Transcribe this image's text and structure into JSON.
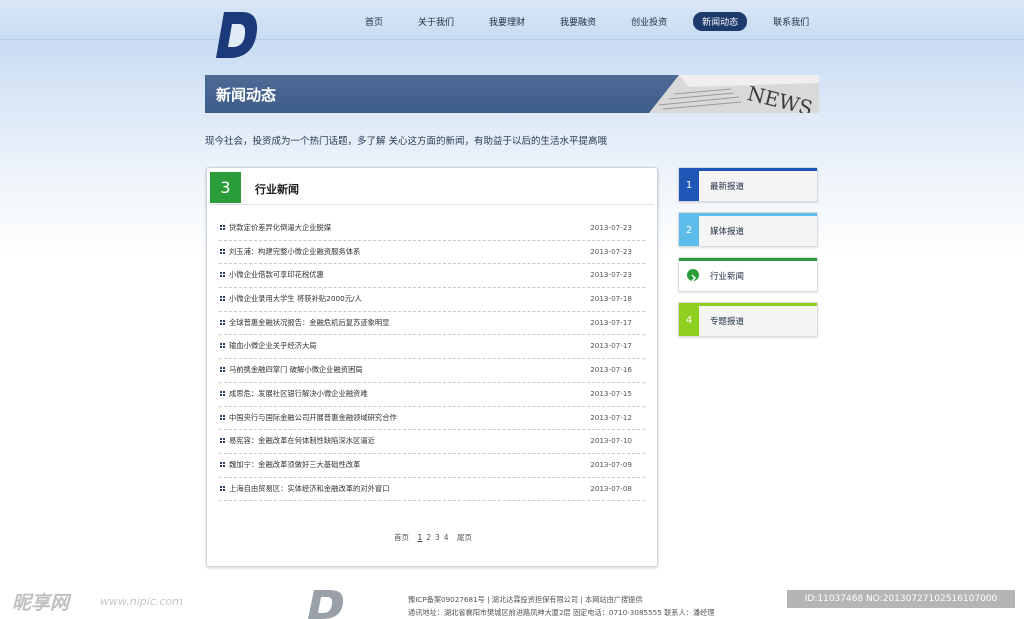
{
  "brand": {
    "logo_letter": "D"
  },
  "nav": {
    "items": [
      {
        "label": "首页",
        "active": false
      },
      {
        "label": "关于我们",
        "active": false
      },
      {
        "label": "我要理财",
        "active": false
      },
      {
        "label": "我要融资",
        "active": false
      },
      {
        "label": "创业投资",
        "active": false
      },
      {
        "label": "新闻动态",
        "active": true
      },
      {
        "label": "联系我们",
        "active": false
      }
    ]
  },
  "banner": {
    "title": "新闻动态",
    "image_text": "NEWS"
  },
  "intro": "现今社会，投资成为一个热门话题，多了解 关心这方面的新闻，有助益于以后的生活水平提高哦",
  "panel": {
    "number": "3",
    "title": "行业新闻",
    "news": [
      {
        "title": "贷款定价差异化倒逼大企业脱媒",
        "date": "2013-07-23"
      },
      {
        "title": "刘玉浦：构建完整小微企业融资服务体系",
        "date": "2013-07-23"
      },
      {
        "title": "小微企业借款可享印花税优惠",
        "date": "2013-07-23"
      },
      {
        "title": "小微企业录用大学生 将获补贴2000元/人",
        "date": "2013-07-18"
      },
      {
        "title": "全球普惠金融状况报告：金融危机后复苏迹象明显",
        "date": "2013-07-17"
      },
      {
        "title": "输血小微企业关乎经济大局",
        "date": "2013-07-17"
      },
      {
        "title": "马前携金融四掌门 破解小微企业融资困局",
        "date": "2013-07-16"
      },
      {
        "title": "成思危：发展社区银行解决小微企业融资难",
        "date": "2013-07-15"
      },
      {
        "title": "中国央行与国际金融公司开展普惠金融领域研究合作",
        "date": "2013-07-12"
      },
      {
        "title": "易宪容：金融改革在何体制性缺陷深水区逼近",
        "date": "2013-07-10"
      },
      {
        "title": "魏加宁：金融改革须做好三大基础性改革",
        "date": "2013-07-09"
      },
      {
        "title": "上海自由贸易区：实体经济和金融改革的对外窗口",
        "date": "2013-07-08"
      }
    ],
    "pager": {
      "first": "首页",
      "pages": [
        "1",
        "2",
        "3",
        "4"
      ],
      "current": "1",
      "last": "尾页"
    }
  },
  "sidebar": {
    "items": [
      {
        "num": "1",
        "label": "最新报道",
        "color": "#1f56b5",
        "active": false
      },
      {
        "num": "2",
        "label": "媒体报道",
        "color": "#5cbcea",
        "active": false
      },
      {
        "num": "",
        "label": "行业新闻",
        "color": "#2a9d3a",
        "active": true
      },
      {
        "num": "4",
        "label": "专题报道",
        "color": "#8fcf1f",
        "active": false
      }
    ]
  },
  "footer": {
    "line1": "豫ICP备案09027681号 | 湖北达霖投资担保有限公司 | 本网站由广搜提供",
    "line2": "通讯地址：湖北省襄阳市樊城区前进路凤神大厦2层 固定电话：0710-3085555 联系人：潘经理"
  },
  "watermark": {
    "site": "昵享网",
    "url": "www.nipic.com",
    "id": "ID:11037468 NO:20130727102516107000"
  },
  "colors": {
    "nav_active": "#1c3a6b",
    "banner": "#4d6a95",
    "green": "#2a9d3a"
  }
}
